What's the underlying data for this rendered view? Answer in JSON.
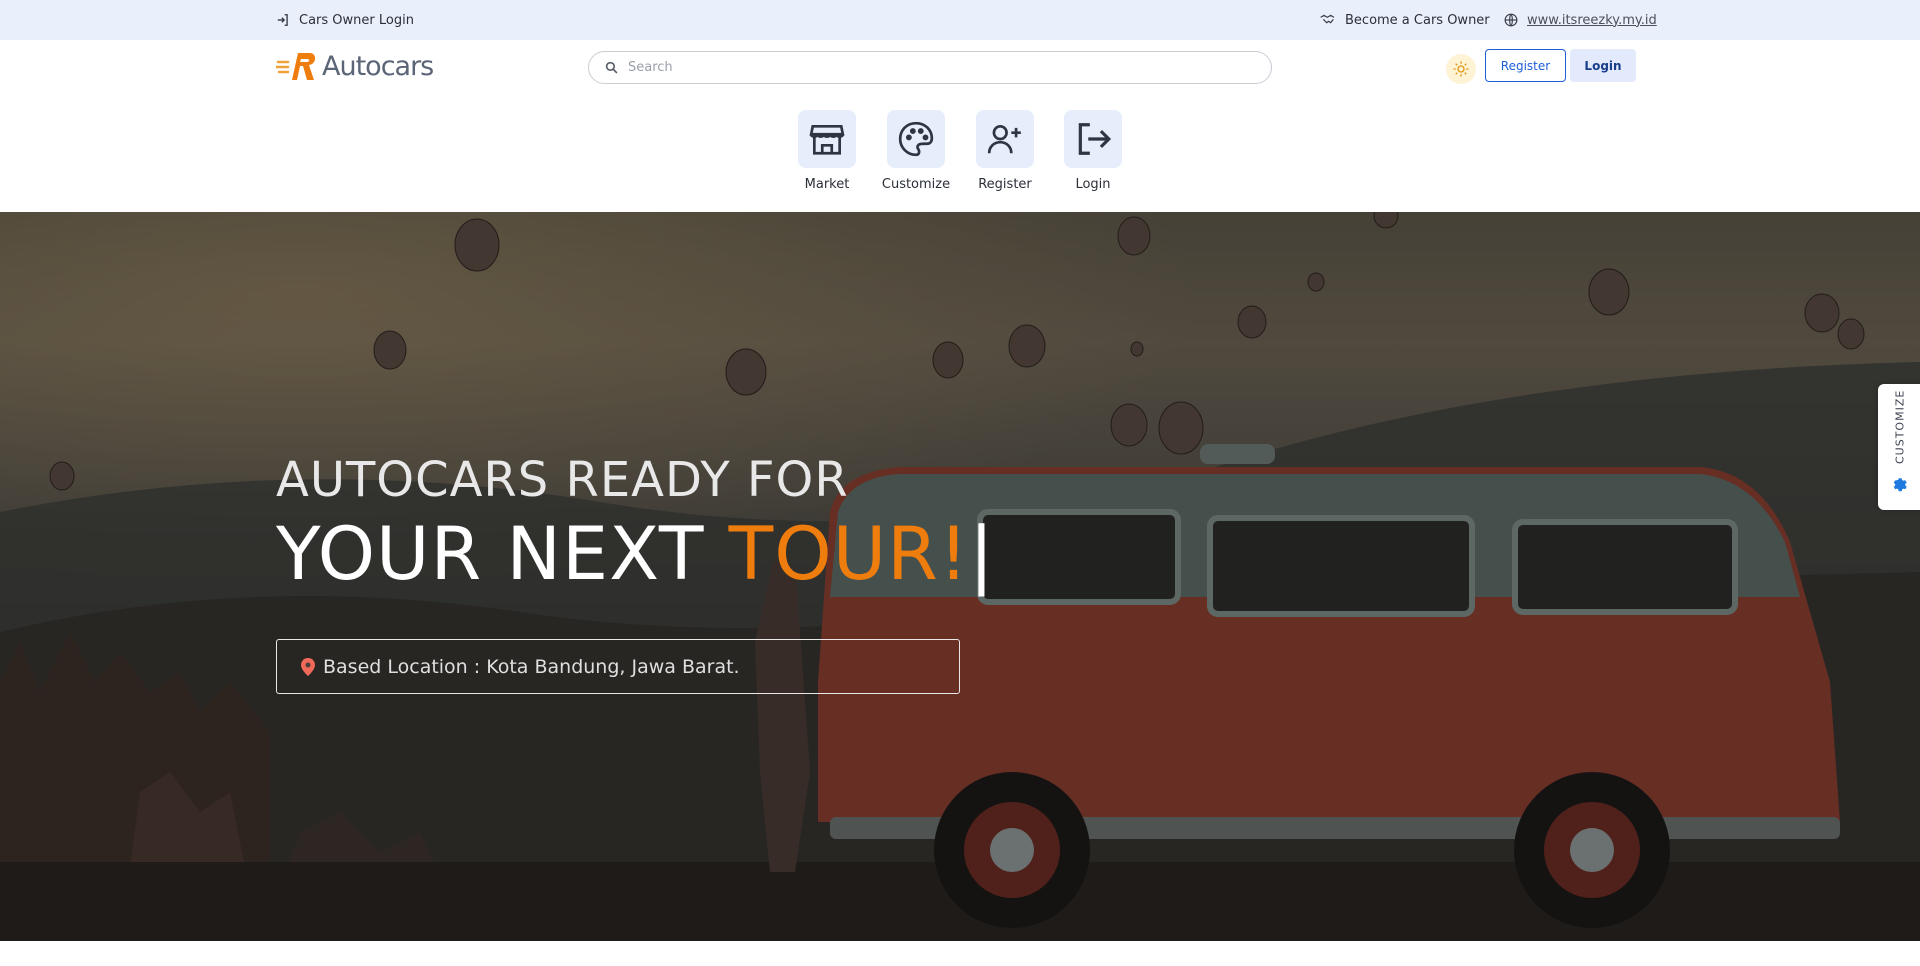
{
  "topbar": {
    "owner_login": "Cars Owner Login",
    "become_owner": "Become a Cars Owner",
    "website": "www.itsreezky.my.id"
  },
  "header": {
    "logo_text": "Autocars",
    "search_placeholder": "Search",
    "register_label": "Register",
    "login_label": "Login"
  },
  "quick_nav": [
    {
      "label": "Market",
      "icon": "store-icon"
    },
    {
      "label": "Customize",
      "icon": "palette-icon"
    },
    {
      "label": "Register",
      "icon": "user-plus-icon"
    },
    {
      "label": "Login",
      "icon": "logout-icon"
    }
  ],
  "hero": {
    "line1": "AUTOCARS READY FOR",
    "line2_prefix": "YOUR NEXT ",
    "line2_accent": "TOUR!",
    "cursor": "|",
    "location_text": "Based Location : Kota Bandung, Jawa Barat."
  },
  "customize_tab": {
    "label": "CUSTOMIZE",
    "icon": "gear-icon"
  },
  "colors": {
    "accent": "#ef7d0e",
    "primary": "#1f5fd6",
    "topbar_bg": "#e9effb",
    "tile_bg": "#e6edfb"
  }
}
